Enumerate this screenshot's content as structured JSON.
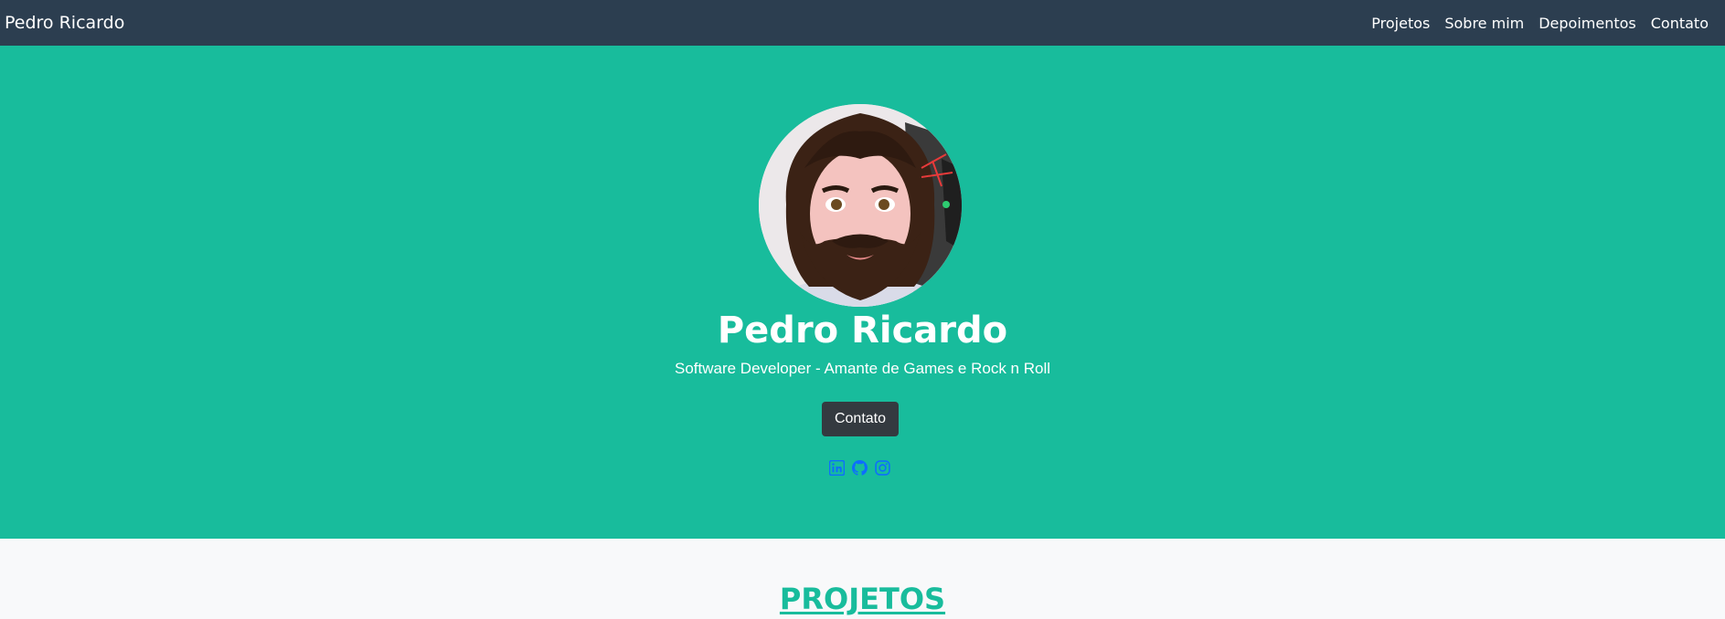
{
  "navbar": {
    "brand": "Pedro Ricardo",
    "links": [
      "Projetos",
      "Sobre mim",
      "Depoimentos",
      "Contato"
    ]
  },
  "hero": {
    "name": "Pedro Ricardo",
    "subtitle": "Software Developer - Amante de Games e Rock n Roll",
    "contact_button": "Contato",
    "social_icons": [
      "linkedin-icon",
      "github-icon",
      "instagram-icon"
    ]
  },
  "projects": {
    "title": "PROJETOS"
  },
  "colors": {
    "navbar_bg": "#2c3e50",
    "hero_bg": "#18bc9c",
    "button_bg": "#343a40",
    "social_icon": "#0d6efd",
    "section_bg": "#f8f9fa",
    "title_accent": "#18bc9c"
  }
}
